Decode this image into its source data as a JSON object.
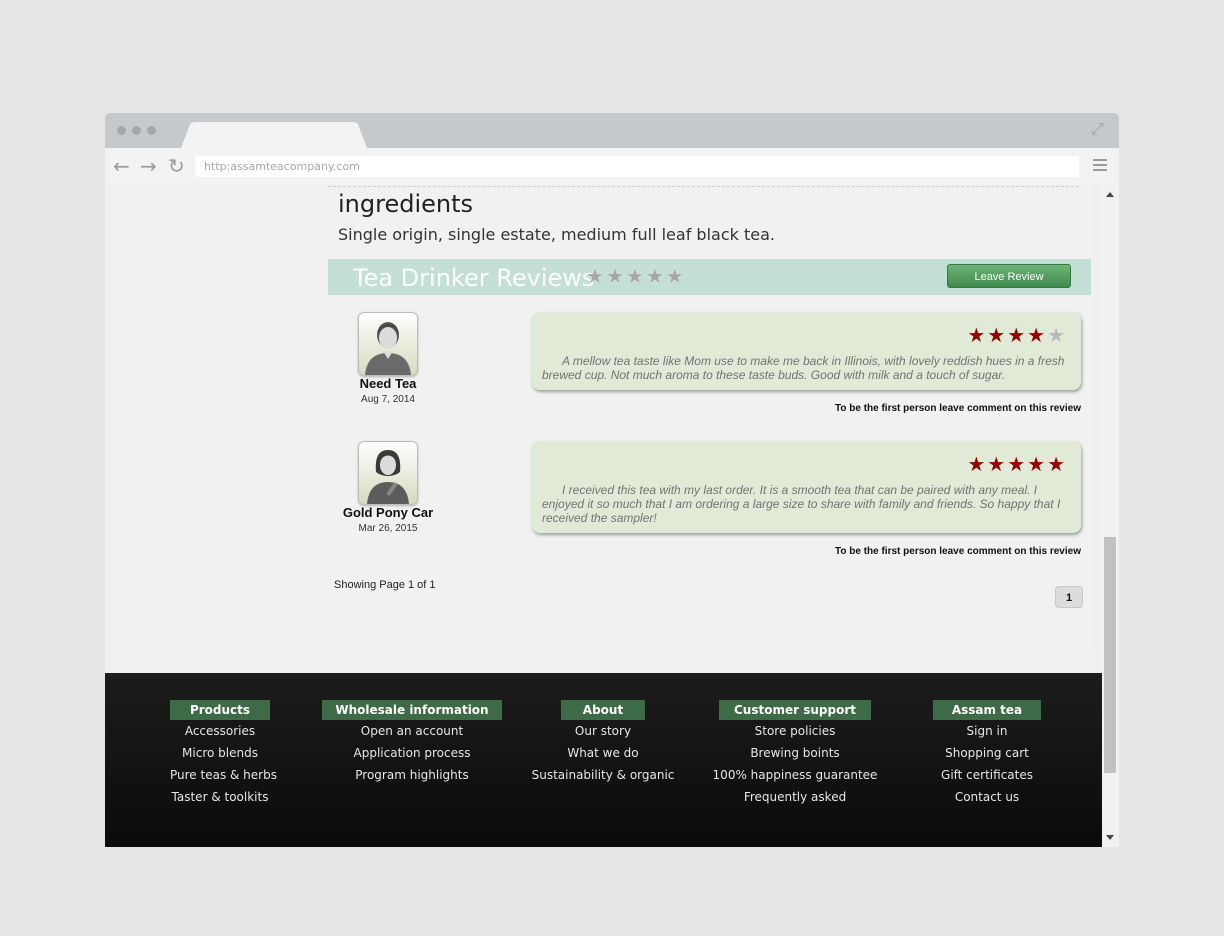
{
  "browser": {
    "url": "http:assamteacompany.com",
    "icons": {
      "back": "arrow-left-icon",
      "forward": "arrow-right-icon",
      "reload": "reload-icon",
      "menu": "hamburger-icon",
      "expand": "expand-icon"
    }
  },
  "ingredients": {
    "title": "ingredients",
    "text": "Single origin, single estate, medium full leaf black tea."
  },
  "reviews_header": {
    "title": "Tea Drinker Reviews",
    "overall_rating": 0,
    "leave_button": "Leave Review"
  },
  "reviews": [
    {
      "name": "Need Tea",
      "date": "Aug 7, 2014",
      "rating": 4,
      "text": "A mellow tea taste like Mom use to make me back in Illinois, with lovely reddish hues in a fresh brewed cup. Not much aroma to these taste buds. Good with milk and a touch of sugar.",
      "comment_prompt": "To be the first person leave comment on this review",
      "avatar": "male-user-icon"
    },
    {
      "name": "Gold Pony Car",
      "date": "Mar 26, 2015",
      "rating": 5,
      "text": "I received this tea with my last order. It is a smooth tea that can be paired with any meal. I enjoyed it so much that I am ordering a large size to share with family and friends. So happy that I received the sampler!",
      "comment_prompt": "To be the first person leave comment on this review",
      "avatar": "female-user-icon"
    }
  ],
  "pagination": {
    "showing": "Showing Page 1 of 1",
    "current_page": "1"
  },
  "footer": {
    "columns": [
      {
        "heading": "Products",
        "links": [
          "Accessories",
          "Micro blends",
          "Pure teas & herbs",
          "Taster & toolkits"
        ]
      },
      {
        "heading": "Wholesale information",
        "links": [
          "Open an account",
          "Application process",
          "Program highlights"
        ]
      },
      {
        "heading": "About",
        "links": [
          "Our story",
          "What we do",
          "Sustainability & organic"
        ]
      },
      {
        "heading": "Customer support",
        "links": [
          "Store policies",
          "Brewing boints",
          "100% happiness guarantee",
          "Frequently asked"
        ]
      },
      {
        "heading": "Assam tea",
        "links": [
          "Sign in",
          "Shopping cart",
          "Gift certificates",
          "Contact us"
        ]
      }
    ]
  },
  "colors": {
    "star_filled": "#990000",
    "review_bar": "#c3dfd6",
    "footer_heading": "#3d6b45",
    "bubble": "#e0ead7"
  }
}
